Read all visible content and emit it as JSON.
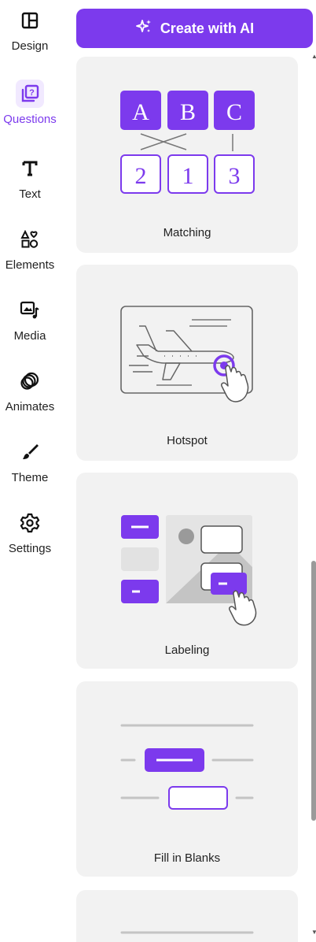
{
  "sidebar": {
    "items": [
      {
        "label": "Design",
        "icon": "layout-icon",
        "active": false
      },
      {
        "label": "Questions",
        "icon": "question-icon",
        "active": true
      },
      {
        "label": "Text",
        "icon": "text-icon",
        "active": false
      },
      {
        "label": "Elements",
        "icon": "shapes-icon",
        "active": false
      },
      {
        "label": "Media",
        "icon": "media-icon",
        "active": false
      },
      {
        "label": "Animates",
        "icon": "animate-icon",
        "active": false
      },
      {
        "label": "Theme",
        "icon": "brush-icon",
        "active": false
      },
      {
        "label": "Settings",
        "icon": "gear-icon",
        "active": false
      }
    ]
  },
  "header": {
    "create_ai_label": "Create with AI",
    "create_ai_icon": "sparkle-icon"
  },
  "cards": {
    "matching": {
      "label": "Matching",
      "top_letters": [
        "A",
        "B",
        "C"
      ],
      "bottom_numbers": [
        "2",
        "1",
        "3"
      ]
    },
    "hotspot": {
      "label": "Hotspot"
    },
    "labeling": {
      "label": "Labeling"
    },
    "fill_blanks": {
      "label": "Fill in Blanks"
    }
  },
  "colors": {
    "accent": "#7c3aed",
    "card_bg": "#f2f2f2",
    "active_bg": "#f1e9ff"
  }
}
